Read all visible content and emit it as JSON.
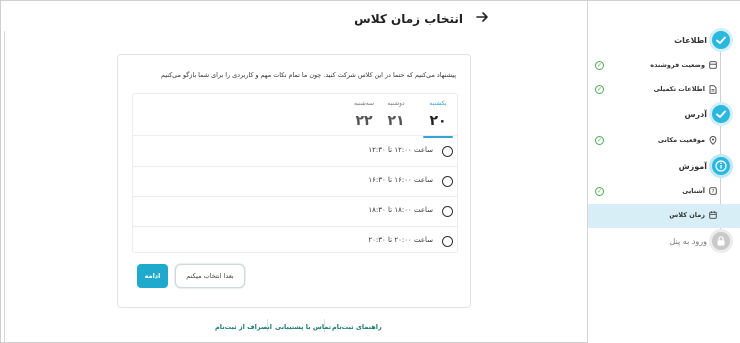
{
  "header": {
    "title": "انتخاب زمان کلاس",
    "back_icon": "arrow-right-icon"
  },
  "hint": "پیشنهاد می‌کنیم که حتما در این کلاس شرکت کنید. چون ما تمام نکات مهم و کاربردی را برای شما بازگو می‌کنیم",
  "days": [
    {
      "name": "یکشنبه",
      "num": "۲۰",
      "active": true
    },
    {
      "name": "دوشنبه",
      "num": "۲۱",
      "active": false
    },
    {
      "name": "سه‌شنبه",
      "num": "۲۲",
      "active": false
    }
  ],
  "slots": [
    "ساعت ۱۲:۰۰ تا ۱۲:۳۰",
    "ساعت ۱۶:۰۰ تا ۱۶:۳۰",
    "ساعت ۱۸:۰۰ تا ۱۸:۳۰",
    "ساعت ۲۰:۰۰ تا ۲۰:۳۰"
  ],
  "buttons": {
    "later": "بعدا انتخاب میکنم",
    "continue": "ادامه"
  },
  "footer": {
    "guide": "راهنمای ثبت‌نام",
    "support": "تماس با پشتیبانی",
    "cancel": "انصراف از ثبت‌نام"
  },
  "sidebar": {
    "steps": [
      {
        "title": "اطلاعات",
        "state": "done",
        "icon": "check-icon"
      },
      {
        "title": "آدرس",
        "state": "done",
        "icon": "check-icon"
      },
      {
        "title": "آموزش",
        "state": "current",
        "icon": "info-icon"
      },
      {
        "title": "ورود به پنل",
        "state": "locked",
        "icon": "lock-icon"
      }
    ],
    "items": [
      {
        "label": "وضعیت فروشنده",
        "icon": "store-icon",
        "checked": true
      },
      {
        "label": "اطلاعات تکمیلی",
        "icon": "document-icon",
        "checked": true
      },
      {
        "label": "موقعیت مکانی",
        "icon": "location-icon",
        "checked": true
      },
      {
        "label": "آشنایی",
        "icon": "help-icon",
        "checked": true
      },
      {
        "label": "زمان کلاس",
        "icon": "calendar-icon",
        "checked": false,
        "selected": true
      }
    ]
  },
  "colors": {
    "accent": "#2bb8df",
    "button": "#1fa9cc",
    "footer_link": "#1c7a6e",
    "check": "#4caf50"
  }
}
